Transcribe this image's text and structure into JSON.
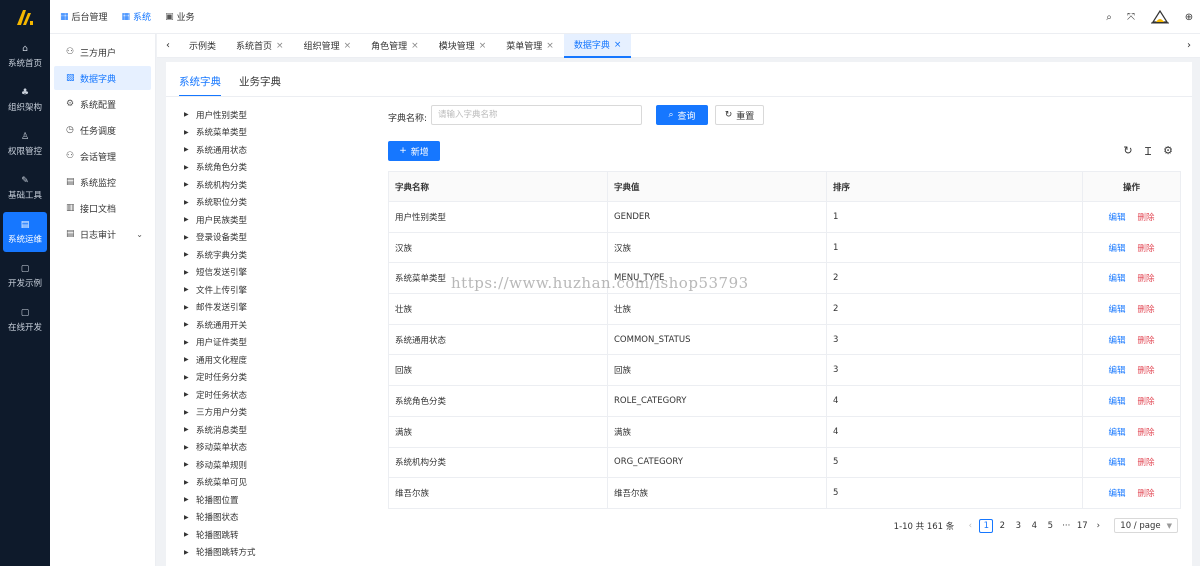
{
  "rail": {
    "items": [
      {
        "label": "系统首页",
        "icon": "home-icon",
        "glyph": "⌂"
      },
      {
        "label": "组织架构",
        "icon": "org-icon",
        "glyph": "♣"
      },
      {
        "label": "权限管控",
        "icon": "user-lock-icon",
        "glyph": "♙"
      },
      {
        "label": "基础工具",
        "icon": "tool-icon",
        "glyph": "✎"
      },
      {
        "label": "系统运维",
        "icon": "server-icon",
        "glyph": "▤"
      },
      {
        "label": "开发示例",
        "icon": "window-icon",
        "glyph": "▢"
      },
      {
        "label": "在线开发",
        "icon": "code-window-icon",
        "glyph": "▢"
      }
    ],
    "active_index": 4
  },
  "topnav": {
    "items": [
      {
        "label": "后台管理",
        "glyph": "▦"
      },
      {
        "label": "系统",
        "glyph": "▦"
      },
      {
        "label": "业务",
        "glyph": "▣"
      }
    ],
    "active_index": 1
  },
  "topright": {
    "search": "⌕",
    "fullscreen": "⤧",
    "lang": "⊕"
  },
  "submenu": {
    "items": [
      {
        "label": "三方用户",
        "glyph": "⚇"
      },
      {
        "label": "数据字典",
        "glyph": "▧"
      },
      {
        "label": "系统配置",
        "glyph": "⚙"
      },
      {
        "label": "任务调度",
        "glyph": "◷"
      },
      {
        "label": "会话管理",
        "glyph": "⚇"
      },
      {
        "label": "系统监控",
        "glyph": "▤"
      },
      {
        "label": "接口文档",
        "glyph": "▥"
      },
      {
        "label": "日志审计",
        "glyph": "▤"
      }
    ],
    "active_index": 1
  },
  "tabs": {
    "items": [
      {
        "label": "示例类",
        "closable": false
      },
      {
        "label": "系统首页",
        "closable": true
      },
      {
        "label": "组织管理",
        "closable": true
      },
      {
        "label": "角色管理",
        "closable": true
      },
      {
        "label": "模块管理",
        "closable": true
      },
      {
        "label": "菜单管理",
        "closable": true
      },
      {
        "label": "数据字典",
        "closable": true
      }
    ],
    "active_index": 6,
    "close_glyph": "×",
    "prev": "‹",
    "next": "›"
  },
  "dict_tabs": {
    "items": [
      "系统字典",
      "业务字典"
    ],
    "active_index": 0
  },
  "tree": {
    "caret": "▶",
    "items": [
      "用户性别类型",
      "系统菜单类型",
      "系统通用状态",
      "系统角色分类",
      "系统机构分类",
      "系统职位分类",
      "用户民族类型",
      "登录设备类型",
      "系统字典分类",
      "短信发送引擎",
      "文件上传引擎",
      "邮件发送引擎",
      "系统通用开关",
      "用户证件类型",
      "通用文化程度",
      "定时任务分类",
      "定时任务状态",
      "三方用户分类",
      "系统消息类型",
      "移动菜单状态",
      "移动菜单规则",
      "系统菜单可见",
      "轮播图位置",
      "轮播图状态",
      "轮播图跳转",
      "轮播图跳转方式"
    ]
  },
  "search": {
    "label": "字典名称:",
    "placeholder": "请输入字典名称",
    "value": "",
    "query_label": "查询",
    "reset_label": "重置",
    "add_label": "新增"
  },
  "table": {
    "columns": [
      "字典名称",
      "字典值",
      "排序",
      "操作"
    ],
    "edit_label": "编辑",
    "delete_label": "删除",
    "rows": [
      {
        "name": "用户性别类型",
        "value": "GENDER",
        "sort": "1"
      },
      {
        "name": "汉族",
        "value": "汉族",
        "sort": "1"
      },
      {
        "name": "系统菜单类型",
        "value": "MENU_TYPE",
        "sort": "2"
      },
      {
        "name": "壮族",
        "value": "壮族",
        "sort": "2"
      },
      {
        "name": "系统通用状态",
        "value": "COMMON_STATUS",
        "sort": "3"
      },
      {
        "name": "回族",
        "value": "回族",
        "sort": "3"
      },
      {
        "name": "系统角色分类",
        "value": "ROLE_CATEGORY",
        "sort": "4"
      },
      {
        "name": "满族",
        "value": "满族",
        "sort": "4"
      },
      {
        "name": "系统机构分类",
        "value": "ORG_CATEGORY",
        "sort": "5"
      },
      {
        "name": "维吾尔族",
        "value": "维吾尔族",
        "sort": "5"
      }
    ]
  },
  "pager": {
    "total": "1-10 共 161 条",
    "prev": "‹",
    "next": "›",
    "pages": [
      "1",
      "2",
      "3",
      "4",
      "5",
      "···",
      "17"
    ],
    "active_page": "1",
    "size": "10 / page"
  },
  "watermark": "https://www.huzhan.com/ishop53793",
  "colors": {
    "primary": "#1677ff",
    "danger": "#e34d59",
    "rail": "#0e1a2b"
  }
}
